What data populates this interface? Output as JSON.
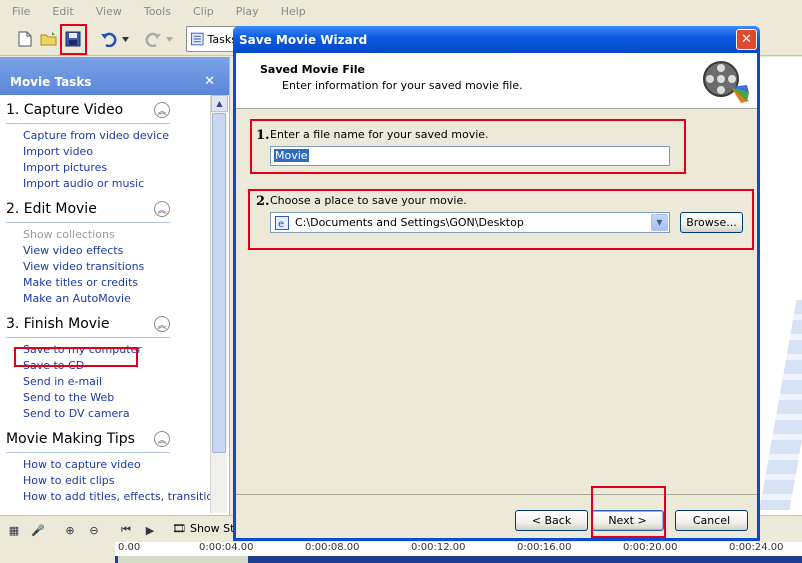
{
  "menu": [
    "File",
    "Edit",
    "View",
    "Tools",
    "Clip",
    "Play",
    "Help"
  ],
  "toolbar": {
    "tasks_label": "Tasks"
  },
  "left_panel": {
    "title": "Movie Tasks",
    "sections": [
      {
        "title": "1. Capture Video",
        "items": [
          "Capture from video device",
          "Import video",
          "Import pictures",
          "Import audio or music"
        ]
      },
      {
        "title": "2. Edit Movie",
        "items": [
          "Show collections",
          "View video effects",
          "View video transitions",
          "Make titles or credits",
          "Make an AutoMovie"
        ]
      },
      {
        "title": "3. Finish Movie",
        "items": [
          "Save to my computer",
          "Save to CD",
          "Send in e-mail",
          "Send to the Web",
          "Send to DV camera"
        ]
      },
      {
        "title": "Movie Making Tips",
        "items": [
          "How to capture video",
          "How to edit clips",
          "How to add titles, effects, transitions"
        ]
      }
    ]
  },
  "timeline": {
    "show_label": "Show Sto",
    "ticks": [
      "0.00",
      "0:00:04.00",
      "0:00:08.00",
      "0:00:12.00",
      "0:00:16.00",
      "0:00:20.00",
      "0:00:24.00"
    ]
  },
  "dialog": {
    "title": "Save Movie Wizard",
    "close_glyph": "✕",
    "header_title": "Saved Movie File",
    "header_subtitle": "Enter information for your saved movie file.",
    "step1_num": "1.",
    "step1_label": "Enter a file name for your saved movie.",
    "filename": "Movie",
    "step2_num": "2.",
    "step2_label": "Choose a place to save your movie.",
    "location": "C:\\Documents and Settings\\GON\\Desktop",
    "browse": "Browse...",
    "back": "< Back",
    "next": "Next >",
    "cancel": "Cancel"
  },
  "colors": {
    "highlight_box": "#e0001a",
    "xp_title_blue": "#0b5ae0",
    "link_blue": "#1a3aa8"
  }
}
